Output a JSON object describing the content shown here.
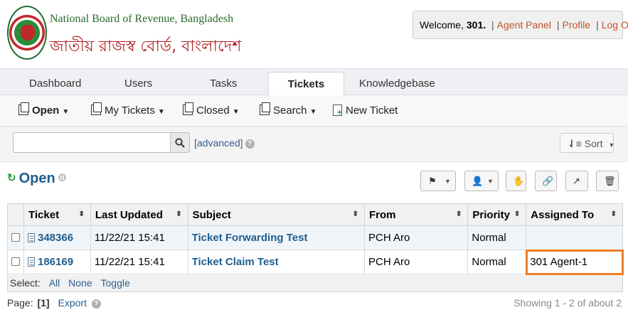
{
  "header": {
    "org_name_en": "National Board of Revenue, Bangladesh",
    "org_name_bn": "জাতীয় রাজস্ব বোর্ড, বাংলাদেশ",
    "welcome_prefix": "Welcome,",
    "user": "301.",
    "agent_panel": "Agent Panel",
    "profile": "Profile",
    "logout": "Log Out",
    "separator": "|"
  },
  "tabs": [
    {
      "label": "Dashboard"
    },
    {
      "label": "Users"
    },
    {
      "label": "Tasks"
    },
    {
      "label": "Tickets",
      "active": true
    },
    {
      "label": "Knowledgebase"
    }
  ],
  "subnav": {
    "open": "Open",
    "my_tickets": "My Tickets",
    "closed": "Closed",
    "search": "Search",
    "new_ticket": "New Ticket"
  },
  "search": {
    "value": "",
    "advanced": "[advanced]",
    "sort": "Sort"
  },
  "queue": {
    "title": "Open"
  },
  "table": {
    "headers": [
      "Ticket",
      "Last Updated",
      "Subject",
      "From",
      "Priority",
      "Assigned To"
    ],
    "rows": [
      {
        "ticket": "348366",
        "updated": "11/22/21 15:41",
        "subject": "Ticket Forwarding Test",
        "from": "PCH Aro",
        "priority": "Normal",
        "assigned": ""
      },
      {
        "ticket": "186169",
        "updated": "11/22/21 15:41",
        "subject": "Ticket Claim Test",
        "from": "PCH Aro",
        "priority": "Normal",
        "assigned": "301 Agent-1"
      }
    ]
  },
  "select": {
    "label": "Select:",
    "all": "All",
    "none": "None",
    "toggle": "Toggle"
  },
  "pager": {
    "label": "Page:",
    "current": "[1]",
    "export": "Export",
    "showing": "Showing 1 - 2 of about 2"
  },
  "colors": {
    "accent_link": "#1f5f8f",
    "highlight": "#f07d22",
    "logout_link": "#c4522a"
  }
}
